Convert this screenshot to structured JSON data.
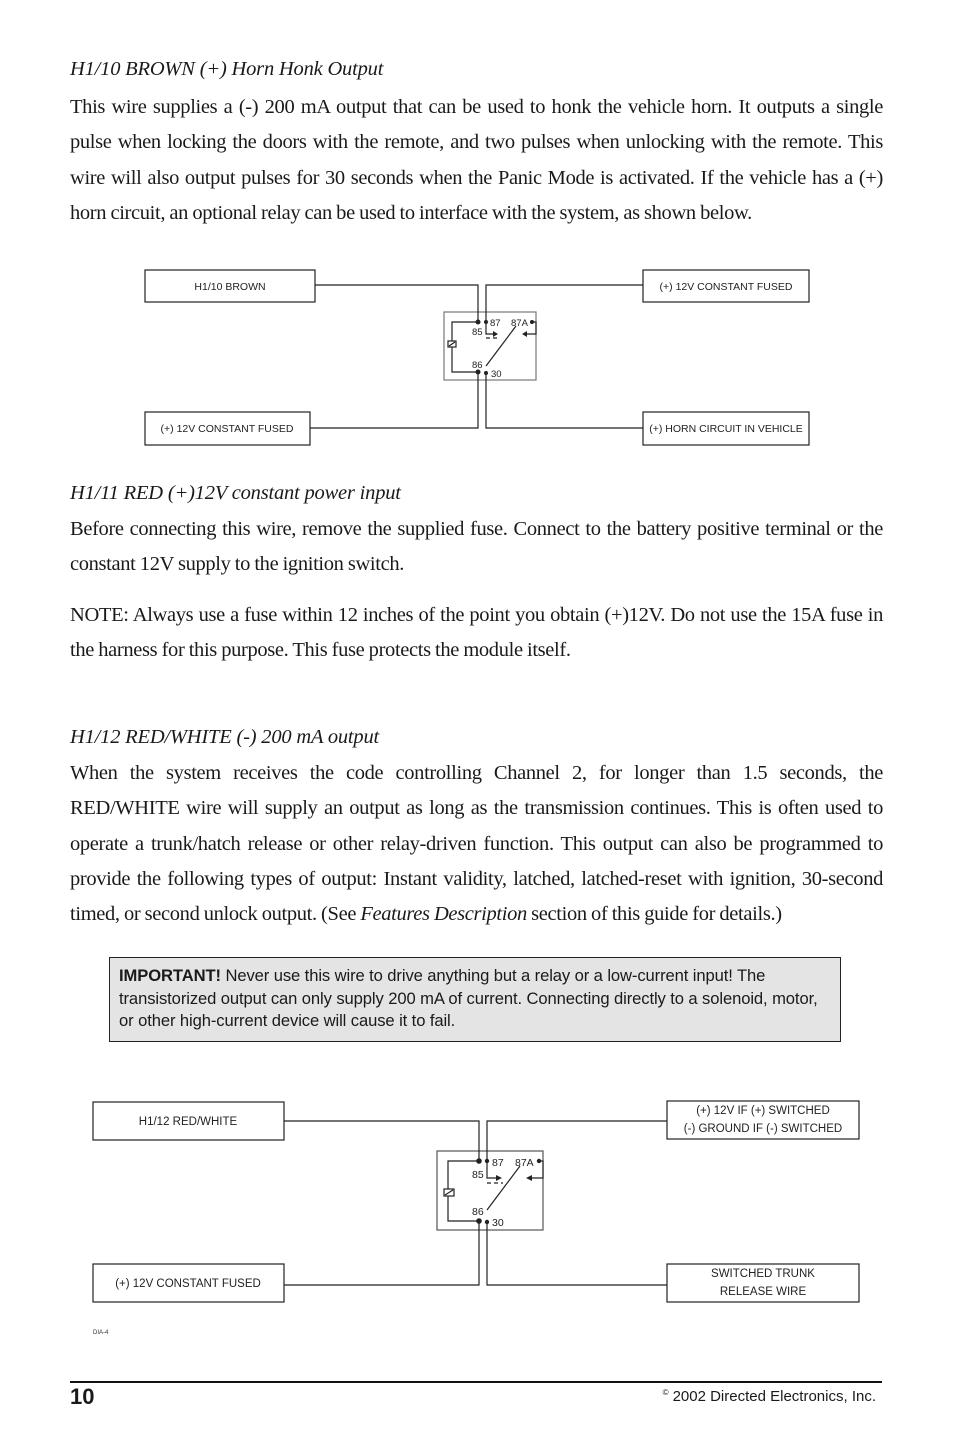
{
  "sections": [
    {
      "heading": "H1/10 BROWN (+) Horn Honk Output",
      "paragraphs": [
        "This wire supplies a (-) 200 mA output that can be used to honk the vehicle horn. It outputs a single pulse when locking the doors with the remote, and two pulses when unlocking with the remote. This wire will also output pulses for 30 seconds when the Panic Mode is activated. If the vehicle has a (+) horn circuit, an optional relay can be used to interface with the system, as shown below."
      ]
    },
    {
      "heading": "H1/11 RED (+)12V constant power input",
      "paragraphs": [
        "Before connecting this wire, remove the supplied fuse. Connect to the battery positive terminal or the constant 12V supply to the ignition switch.",
        "NOTE: Always use a fuse within 12 inches of the point you obtain (+)12V. Do not use the 15A fuse in the harness for this purpose. This fuse protects the module itself."
      ]
    },
    {
      "heading": "H1/12 RED/WHITE (-) 200 mA output",
      "paragraph_before_italic": "When the system receives the code controlling Channel 2, for longer than 1.5 seconds, the RED/WHITE wire will supply an output as long as the transmission continues. This is often used to operate a trunk/hatch release or other relay-driven function. This output can also be programmed to provide the following types of output: Instant validity, latched, latched-reset with ignition, 30-second timed, or second unlock output. (See ",
      "paragraph_italic": "Features Description",
      "paragraph_after_italic": " section of this guide for details.)"
    }
  ],
  "notice": {
    "label": "IMPORTANT!",
    "text": " Never use this wire to drive anything but a relay or a low-current input! The transistorized output can only supply 200 mA of current. Connecting directly to a solenoid, motor, or other high-current device will cause it to fail."
  },
  "diagrams": [
    {
      "top_left": [
        "H1/10 BROWN"
      ],
      "top_right": [
        "(+) 12V CONSTANT FUSED"
      ],
      "bottom_left": [
        "(+) 12V CONSTANT FUSED"
      ],
      "bottom_right": [
        "(+) HORN CIRCUIT IN VEHICLE"
      ],
      "relay_pins": {
        "p85": "85",
        "p86": "86",
        "p87": "87",
        "p87a": "87A",
        "p30": "30"
      }
    },
    {
      "top_left": [
        "H1/12 RED/WHITE"
      ],
      "top_right": [
        "(+) 12V IF (+) SWITCHED",
        "(-) GROUND IF (-) SWITCHED"
      ],
      "bottom_left": [
        "(+) 12V CONSTANT FUSED"
      ],
      "bottom_right": [
        "SWITCHED TRUNK",
        "RELEASE WIRE"
      ],
      "relay_pins": {
        "p85": "85",
        "p86": "86",
        "p87": "87",
        "p87a": "87A",
        "p30": "30"
      },
      "figure_id": "DIA-4"
    }
  ],
  "footer": {
    "page_number": "10",
    "copyright_symbol": "©",
    "copyright_text": "2002 Directed Electronics, Inc."
  }
}
